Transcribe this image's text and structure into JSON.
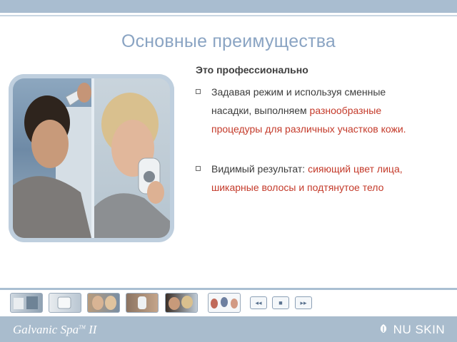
{
  "slide": {
    "title": "Основные преимущества",
    "subheading": "Это профессионально",
    "bullets": [
      {
        "line1": "Задавая режим и  используя сменные",
        "line2_plain": "насадки, выполняем ",
        "line2_accent": "разнообразные",
        "line3_accent": "процедуры для различных участков кожи."
      },
      {
        "line1_plain": "Видимый результат:  ",
        "line1_accent": "сияющий цвет лица,",
        "line2_accent": "шикарные волосы и подтянутое тело"
      }
    ]
  },
  "thumbnails": [
    {
      "name": "thumb-1"
    },
    {
      "name": "thumb-2"
    },
    {
      "name": "thumb-3"
    },
    {
      "name": "thumb-4"
    },
    {
      "name": "thumb-5"
    },
    {
      "name": "thumb-6"
    }
  ],
  "nav": {
    "prev_glyph": "◂◂",
    "stop_glyph": "■",
    "next_glyph": "▸▸"
  },
  "footer": {
    "product": "Galvanic Spa",
    "product_tm": "TM",
    "product_version": " II",
    "brand_icon": "nu-skin-logo-icon",
    "brand": "NU SKIN"
  },
  "colors": {
    "accent": "#c43a2a",
    "title": "#8aa4c3",
    "band": "#a9bccd"
  }
}
